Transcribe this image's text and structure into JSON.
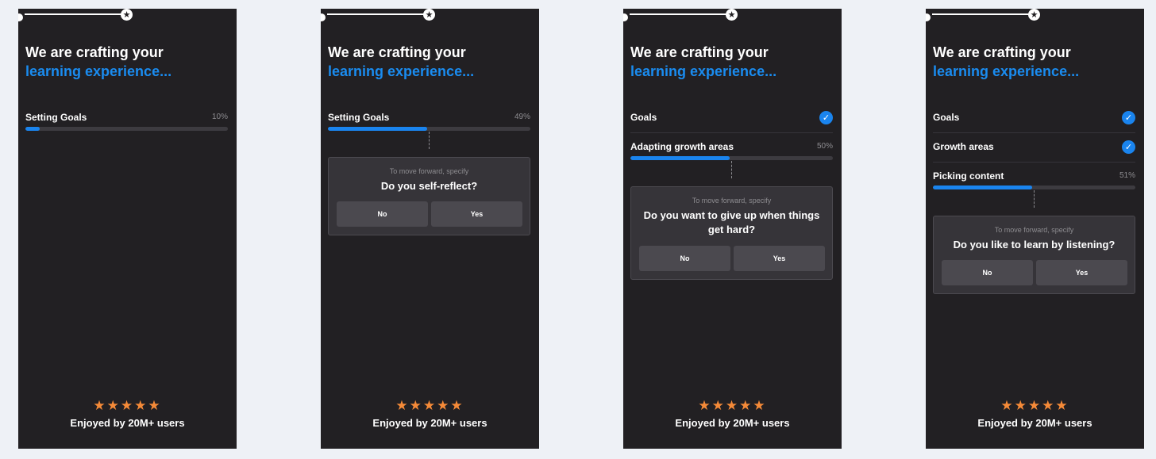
{
  "colors": {
    "background": "#eef1f6",
    "screen": "#222023",
    "accent": "#1a84ee",
    "star": "#f58a38"
  },
  "common": {
    "title_line1": "We are crafting your",
    "title_line2": "learning experience...",
    "stars": "★★★★★",
    "rating_text": "Enjoyed by 20M+ users",
    "prompt_hint": "To move forward, specify",
    "no_label": "No",
    "yes_label": "Yes",
    "top_star_icon": "★",
    "check_icon": "✓"
  },
  "screens": [
    {
      "steps": [
        {
          "label": "Setting Goals",
          "percent_text": "10%",
          "progress": 0.07
        }
      ]
    },
    {
      "steps": [
        {
          "label": "Setting Goals",
          "percent_text": "49%",
          "progress": 0.49
        }
      ],
      "question": "Do you self-reflect?"
    },
    {
      "steps": [
        {
          "label": "Goals",
          "completed": true
        },
        {
          "label": "Adapting growth areas",
          "percent_text": "50%",
          "progress": 0.49
        }
      ],
      "question": "Do you want to give up when things get hard?"
    },
    {
      "steps": [
        {
          "label": "Goals",
          "completed": true
        },
        {
          "label": "Growth areas",
          "completed": true
        },
        {
          "label": "Picking content",
          "percent_text": "51%",
          "progress": 0.49
        }
      ],
      "question": "Do you like to learn by listening?"
    }
  ]
}
